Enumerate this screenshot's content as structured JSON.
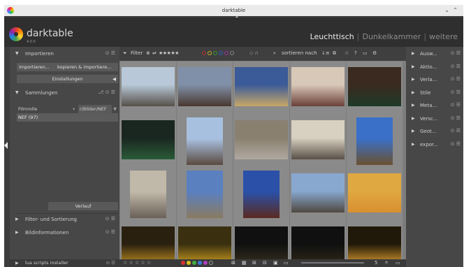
{
  "window": {
    "title": "darktable"
  },
  "app": {
    "name": "darktable",
    "version": "4.0.0"
  },
  "views": {
    "active": "Leuchttisch",
    "items": [
      "Dunkelkammer",
      "weitere"
    ]
  },
  "left": {
    "import": {
      "title": "Importieren",
      "btn1": "importieren...",
      "btn2": "kopieren & importiere...",
      "settings": "Einstellungen"
    },
    "collections": {
      "title": "Sammlungen",
      "property": "Filmrolle",
      "path": "r/Bilder/NEF",
      "selected": "NEF (97)",
      "history": "Verlauf"
    },
    "filter_sort": "Filter- und Sortierung",
    "image_info": "Bildinformationen",
    "lua": "lua scripts installer"
  },
  "toolbar": {
    "filter_label": "Filter",
    "stars": "★★★★★",
    "sort_label": "sortieren nach",
    "question": "?"
  },
  "bottombar": {
    "stars": "☆ ☆ ☆ ☆ ☆",
    "count": "5"
  },
  "right": {
    "items": [
      "Ausw...",
      "Aktio...",
      "Verla...",
      "Stile",
      "Meta...",
      "Versc...",
      "Geot...",
      "expor..."
    ]
  },
  "colors": {
    "labels": [
      "#d83030",
      "#d8c020",
      "#40b040",
      "#3a7ad8",
      "#b040c0"
    ]
  },
  "thumbnails": [
    {
      "top": "#b8c8d8",
      "bottom": "#555048"
    },
    {
      "top": "#8090a8",
      "bottom": "#4a3830"
    },
    {
      "top": "#3a5a98",
      "bottom": "#c8a868"
    },
    {
      "top": "#d8c8b8",
      "bottom": "#6a4038"
    },
    {
      "top": "#3a2a20",
      "bottom": "#1e3a28"
    },
    {
      "top": "#1a2620",
      "bottom": "#2a5a38"
    },
    {
      "top": "#a8c0e0",
      "bottom": "#5a4a40"
    },
    {
      "top": "#8a8070",
      "bottom": "#b0a8a0"
    },
    {
      "top": "#d8d0c0",
      "bottom": "#5a5048"
    },
    {
      "top": "#3a70c8",
      "bottom": "#6a5030"
    },
    {
      "top": "#c0b8a8",
      "bottom": "#6a6058"
    },
    {
      "top": "#5a80c0",
      "bottom": "#8a7a60"
    },
    {
      "top": "#2a50a8",
      "bottom": "#5a2a20"
    },
    {
      "top": "#88a8d0",
      "bottom": "#504840"
    },
    {
      "top": "#e0a840",
      "bottom": "#d89030"
    },
    {
      "top": "#2a2010",
      "bottom": "#c09020"
    },
    {
      "top": "#3a3010",
      "bottom": "#d0a020"
    },
    {
      "top": "#101010",
      "bottom": "#383020"
    },
    {
      "top": "#101010",
      "bottom": "#302818"
    },
    {
      "top": "#201808",
      "bottom": "#e0a030"
    }
  ]
}
